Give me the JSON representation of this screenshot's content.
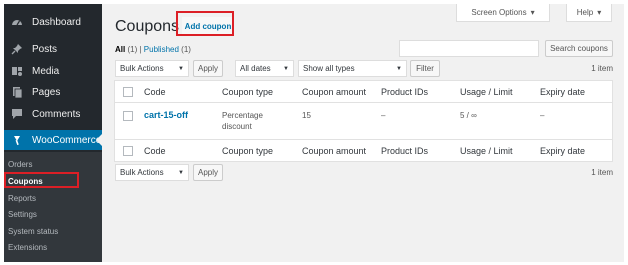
{
  "sidebar": {
    "items": [
      {
        "label": "Dashboard",
        "icon": "dashboard-icon"
      },
      {
        "label": "Posts",
        "icon": "pin-icon"
      },
      {
        "label": "Media",
        "icon": "media-icon"
      },
      {
        "label": "Pages",
        "icon": "page-icon"
      },
      {
        "label": "Comments",
        "icon": "comment-icon"
      },
      {
        "label": "WooCommerce",
        "icon": "woocommerce-icon"
      }
    ],
    "submenu": [
      "Orders",
      "Coupons",
      "Reports",
      "Settings",
      "System status",
      "Extensions"
    ]
  },
  "screen_options_label": "Screen Options",
  "help_label": "Help",
  "page": {
    "title": "Coupons",
    "add_label": "Add coupon"
  },
  "filters": {
    "all_label": "All",
    "all_count": "(1)",
    "separator": "|",
    "published_label": "Published",
    "published_count": "(1)"
  },
  "search": {
    "placeholder": "",
    "button_label": "Search coupons"
  },
  "top_nav": {
    "bulk_actions": "Bulk Actions",
    "apply_label": "Apply",
    "dates": "All dates",
    "types": "Show all types",
    "filter_label": "Filter",
    "count": "1 item"
  },
  "table": {
    "columns": [
      "Code",
      "Coupon type",
      "Coupon amount",
      "Product IDs",
      "Usage / Limit",
      "Expiry date"
    ],
    "rows": [
      {
        "code": "cart-15-off",
        "type_line1": "Percentage",
        "type_line2": "discount",
        "amount": "15",
        "product_ids": "–",
        "usage": "5 / ∞",
        "expiry": "–"
      }
    ]
  },
  "bottom_nav": {
    "bulk_actions": "Bulk Actions",
    "apply_label": "Apply",
    "count": "1 item"
  },
  "colors": {
    "admin_bar": "#23282d",
    "submenu_bg": "#32373c",
    "accent": "#0073aa",
    "highlight_red": "#dc1f26",
    "content_bg": "#f1f1f1"
  }
}
